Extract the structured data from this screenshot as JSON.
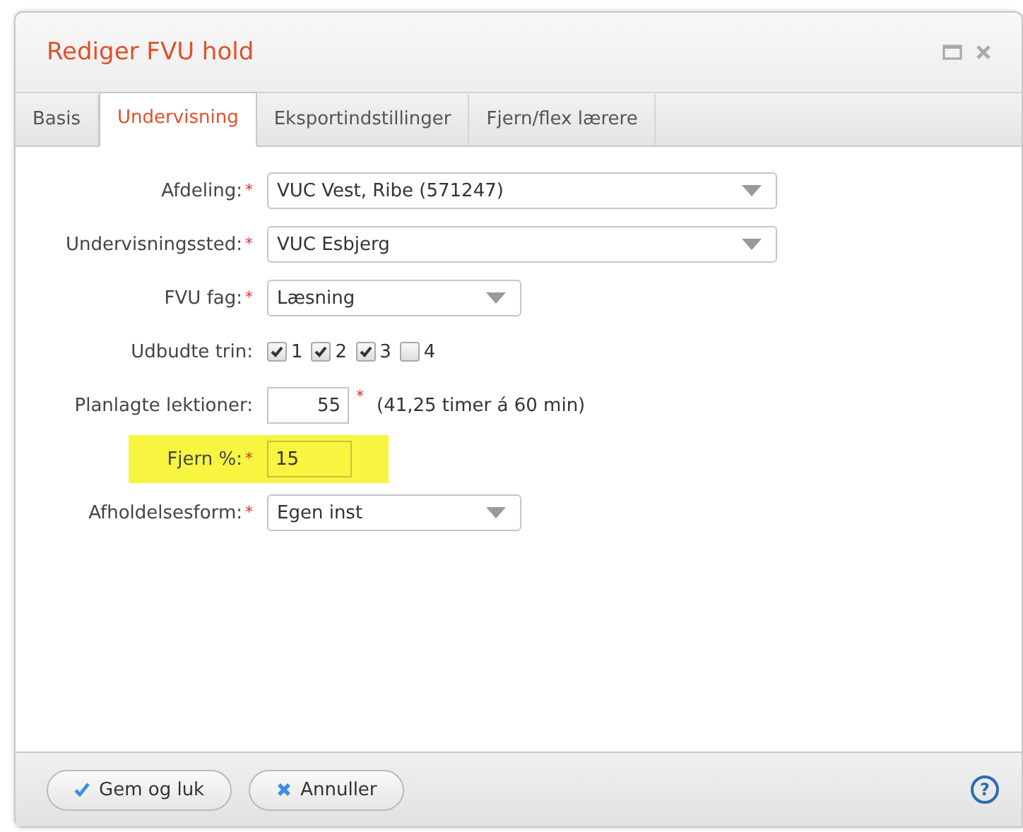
{
  "window": {
    "title": "Rediger FVU hold"
  },
  "tabs": [
    {
      "label": "Basis",
      "selected": false
    },
    {
      "label": "Undervisning",
      "selected": true
    },
    {
      "label": "Eksportindstillinger",
      "selected": false
    },
    {
      "label": "Fjern/flex lærere",
      "selected": false
    }
  ],
  "rows": [
    {
      "kind": "long-select",
      "label": "Afdeling:",
      "required_mark": "*",
      "value": "VUC Vest, Ribe (571247)",
      "highlighted": false
    },
    {
      "kind": "long-select",
      "label": "Undervisningssted:",
      "required_mark": "*",
      "value": "VUC Esbjerg",
      "highlighted": false
    },
    {
      "kind": "short-select",
      "label": "FVU fag:",
      "required_mark": "*",
      "value": "Læsning",
      "highlighted": false
    },
    {
      "kind": "checkboxes",
      "label": "Udbudte trin:",
      "options": [
        {
          "label": "1",
          "checked": true
        },
        {
          "label": "2",
          "checked": true
        },
        {
          "label": "3",
          "checked": true
        },
        {
          "label": "4",
          "checked": false
        }
      ],
      "highlighted": false
    },
    {
      "kind": "number",
      "label": "Planlagte lektioner:",
      "value": "55",
      "input_mark": "*",
      "note": "(41,25 timer á 60 min)",
      "highlighted": false
    },
    {
      "kind": "text",
      "label": "Fjern %:",
      "required_mark": "*",
      "value": "15",
      "highlighted": true
    },
    {
      "kind": "short-select",
      "label": "Afholdelsesform:",
      "required_mark": "*",
      "value": "Egen inst",
      "highlighted": false
    }
  ],
  "buttons": [
    {
      "kind": "save",
      "label": "Gem og luk"
    },
    {
      "kind": "cancel",
      "label": "Annuller"
    }
  ],
  "help": "?"
}
